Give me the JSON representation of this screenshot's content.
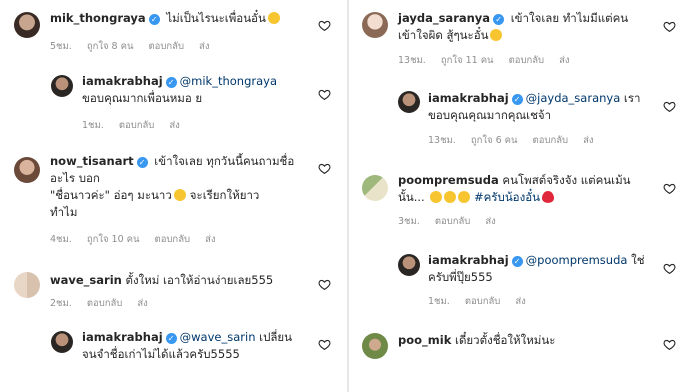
{
  "comments": [
    {
      "user": "mik_thongraya",
      "line1": "ไม่เป็นไรนะเพื่อนอั๋น",
      "emoji1": "😘",
      "line2": "",
      "time": "5ชม.",
      "likes": "ถูกใจ 8 คน",
      "reply": "ตอบกลับ",
      "send": "ส่ง"
    },
    {
      "user": "iamakrabhaj",
      "mention": "@mik_thongraya",
      "line1": "",
      "line2": "ขอบคุณมากเพื่อนหมอ ย",
      "time": "1ชม.",
      "likes": "",
      "reply": "ตอบกลับ",
      "send": "ส่ง"
    },
    {
      "user": "now_tisanart",
      "line1": "เข้าใจเลย ทุกวันนี้คนถามชื่อ",
      "line2": "อะไร บอก",
      "line3": "\"ชื่อนาวค่ะ\" อ่อๆ มะนาว",
      "emoji1": "🙄",
      "line3b": "จะเรียกให้ยาว",
      "line4": "ทำไม",
      "time": "4ชม.",
      "likes": "ถูกใจ 10 คน",
      "reply": "ตอบกลับ",
      "send": "ส่ง"
    },
    {
      "user": "wave_sarin",
      "line1": "ตั้งใหม่ เอาให้อ่านง่ายเลย555",
      "time": "2ชม.",
      "likes": "",
      "reply": "ตอบกลับ",
      "send": "ส่ง"
    },
    {
      "user": "iamakrabhaj",
      "mention": "@wave_sarin",
      "line1": "เปลี่ยน",
      "line2": "จนจำชื่อเก่าไม่ได้แล้วครับ5555",
      "time": "",
      "likes": "",
      "reply": "",
      "send": ""
    },
    {
      "user": "jayda_saranya",
      "line1": "เข้าใจเลย ทำไมมีแต่คน",
      "line2": "เข้าใจผิด สู้ๆนะอั๋น",
      "emoji1": "🙌",
      "time": "13ชม.",
      "likes": "ถูกใจ 11 คน",
      "reply": "ตอบกลับ",
      "send": "ส่ง"
    },
    {
      "user": "iamakrabhaj",
      "mention": "@jayda_saranya",
      "line1": "เรา",
      "line2": "ขอบคุณคุณมากคุณเชจ้า",
      "time": "13ชม.",
      "likes": "ถูกใจ 6 คน",
      "reply": "ตอบกลับ",
      "send": "ส่ง"
    },
    {
      "user": "poompremsuda",
      "line1": "คนโพสต์จริงจัง แต่คนเม้น",
      "line2": "นั้น...",
      "emoji_row": "🤣🤣🤣",
      "hashtag": "#ครับน้องอั๋น",
      "emoji_end": "❤️",
      "time": "3ชม.",
      "likes": "",
      "reply": "ตอบกลับ",
      "send": "ส่ง"
    },
    {
      "user": "iamakrabhaj",
      "mention": "@poompremsuda",
      "line1": "ใช่",
      "line2": "ครับพี่ปุ๊ย555",
      "time": "1ชม.",
      "likes": "",
      "reply": "ตอบกลับ",
      "send": "ส่ง"
    },
    {
      "user": "poo_mik",
      "line1": "เดี๋ยวตั้งชื่อให้ใหม่นะ",
      "time": "",
      "likes": "",
      "reply": "",
      "send": ""
    }
  ],
  "colors": {
    "verified": "#3897f0",
    "mention": "#00376b",
    "meta": "#8e8e8e",
    "hashtag": "#00376b"
  }
}
